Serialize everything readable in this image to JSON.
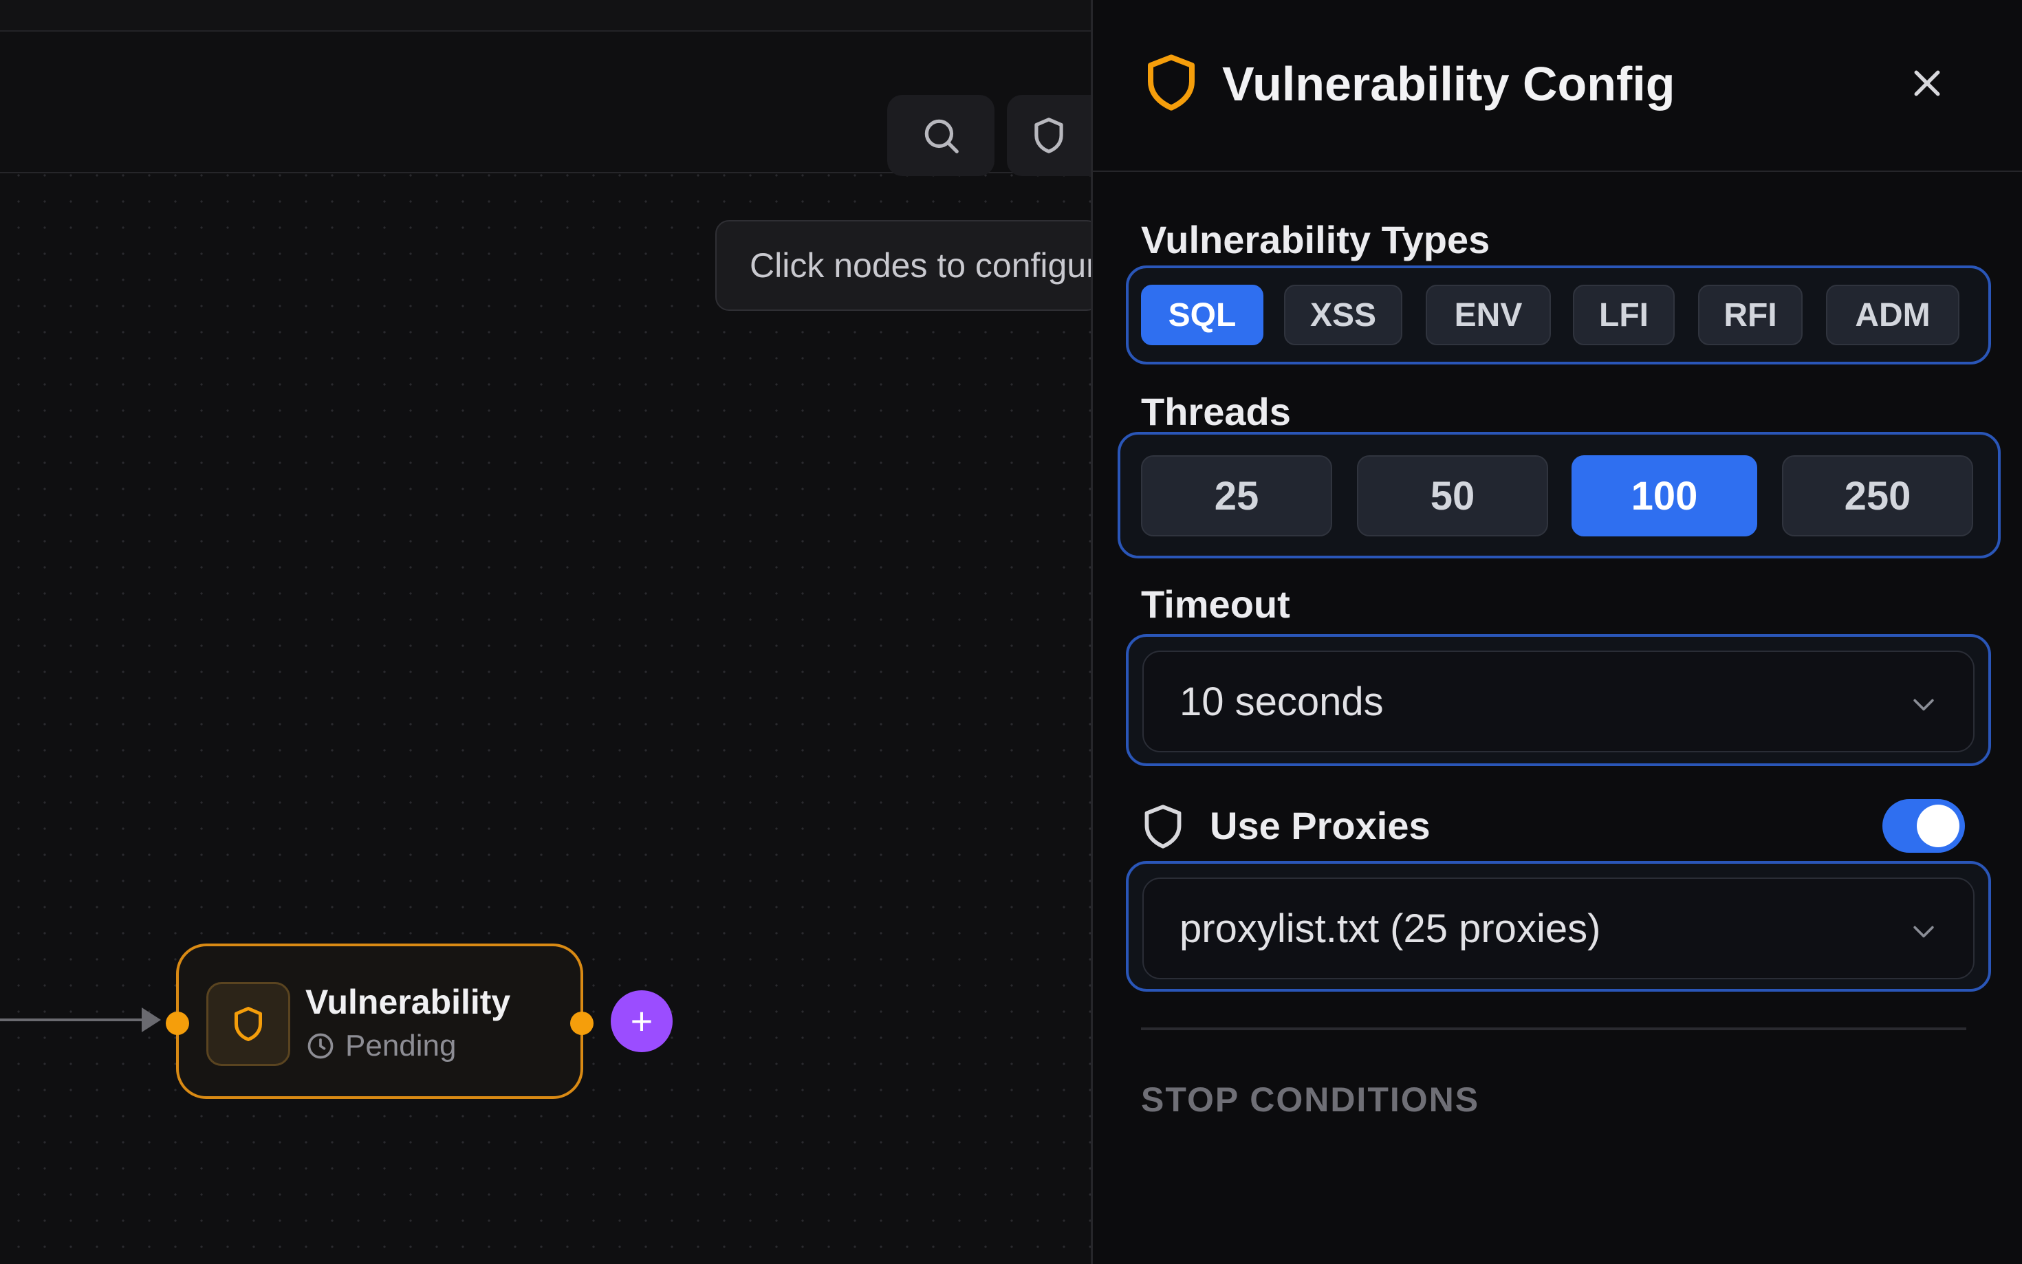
{
  "canvas": {
    "hint_text": "Click nodes to configure",
    "toolbar": {
      "search_icon": "search-icon",
      "shield_icon": "shield-icon"
    },
    "node": {
      "title": "Vulnerability",
      "status": "Pending",
      "icon": "shield-icon",
      "status_icon": "clock-icon",
      "add_label": "+"
    },
    "colors": {
      "node_border": "#d98a14",
      "port": "#f59e0b",
      "add_button": "#9b4dff"
    }
  },
  "panel": {
    "title": "Vulnerability Config",
    "title_icon": "shield-icon",
    "close_icon": "close-icon",
    "vuln_types": {
      "label": "Vulnerability Types",
      "options": [
        "SQL",
        "XSS",
        "ENV",
        "LFI",
        "RFI",
        "ADM"
      ],
      "selected": "SQL"
    },
    "threads": {
      "label": "Threads",
      "options": [
        "25",
        "50",
        "100",
        "250"
      ],
      "selected": "100"
    },
    "timeout": {
      "label": "Timeout",
      "value": "10 seconds"
    },
    "proxies": {
      "label": "Use Proxies",
      "enabled": true,
      "value": "proxylist.txt (25 proxies)"
    },
    "stop_conditions": {
      "heading": "STOP CONDITIONS"
    },
    "colors": {
      "accent": "#2f6ff0",
      "group_border": "#2a56b8",
      "title_icon": "#f59e0b"
    }
  }
}
